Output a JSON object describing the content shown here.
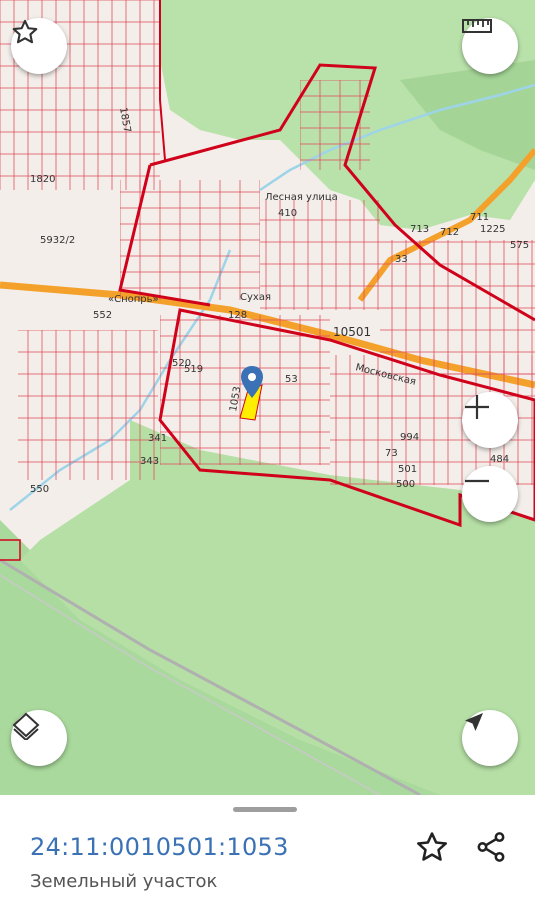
{
  "map": {
    "labels": {
      "street_sukhaya": "Сухая",
      "street_snopr": "«Снопрь»",
      "street_moskovskaya": "Московская",
      "street_lesnaya": "Лесная улица",
      "quarter": "10501",
      "lot_5932": "5932/2",
      "lot_1820": "1820",
      "lot_552": "552",
      "lot_575": "575",
      "lot_711": "711",
      "lot_712": "712",
      "lot_713": "713",
      "lot_341": "341",
      "lot_343": "343",
      "lot_550": "550",
      "lot_520": "520",
      "lot_519": "519",
      "lot_1857": "1857",
      "lot_1225": "1225",
      "lot_128": "128",
      "lot_410": "410",
      "lot_500": "500",
      "lot_501": "501",
      "lot_484": "484",
      "lot_994": "994",
      "lot_33": "33",
      "lot_53": "53",
      "lot_73": "73",
      "lot_1053": "1053"
    },
    "colors": {
      "forest": "#a9d99c",
      "forest_light": "#c4e6b4",
      "background": "#f3eeea",
      "boundary": "#d0021b",
      "parcel": "#e0505f",
      "road": "#f4a12c",
      "water": "#9ed4e8",
      "selected": "#ffee00",
      "marker": "#3a72b5"
    }
  },
  "controls": {
    "favorite_icon": "star-outline",
    "ruler_icon": "ruler",
    "zoom_in_icon": "plus",
    "zoom_out_icon": "minus",
    "layers_icon": "layers",
    "locate_icon": "navigation-arrow"
  },
  "sheet": {
    "cadastral_number": "24:11:0010501:1053",
    "object_type": "Земельный участок",
    "favorite_icon": "star-outline",
    "share_icon": "share"
  }
}
